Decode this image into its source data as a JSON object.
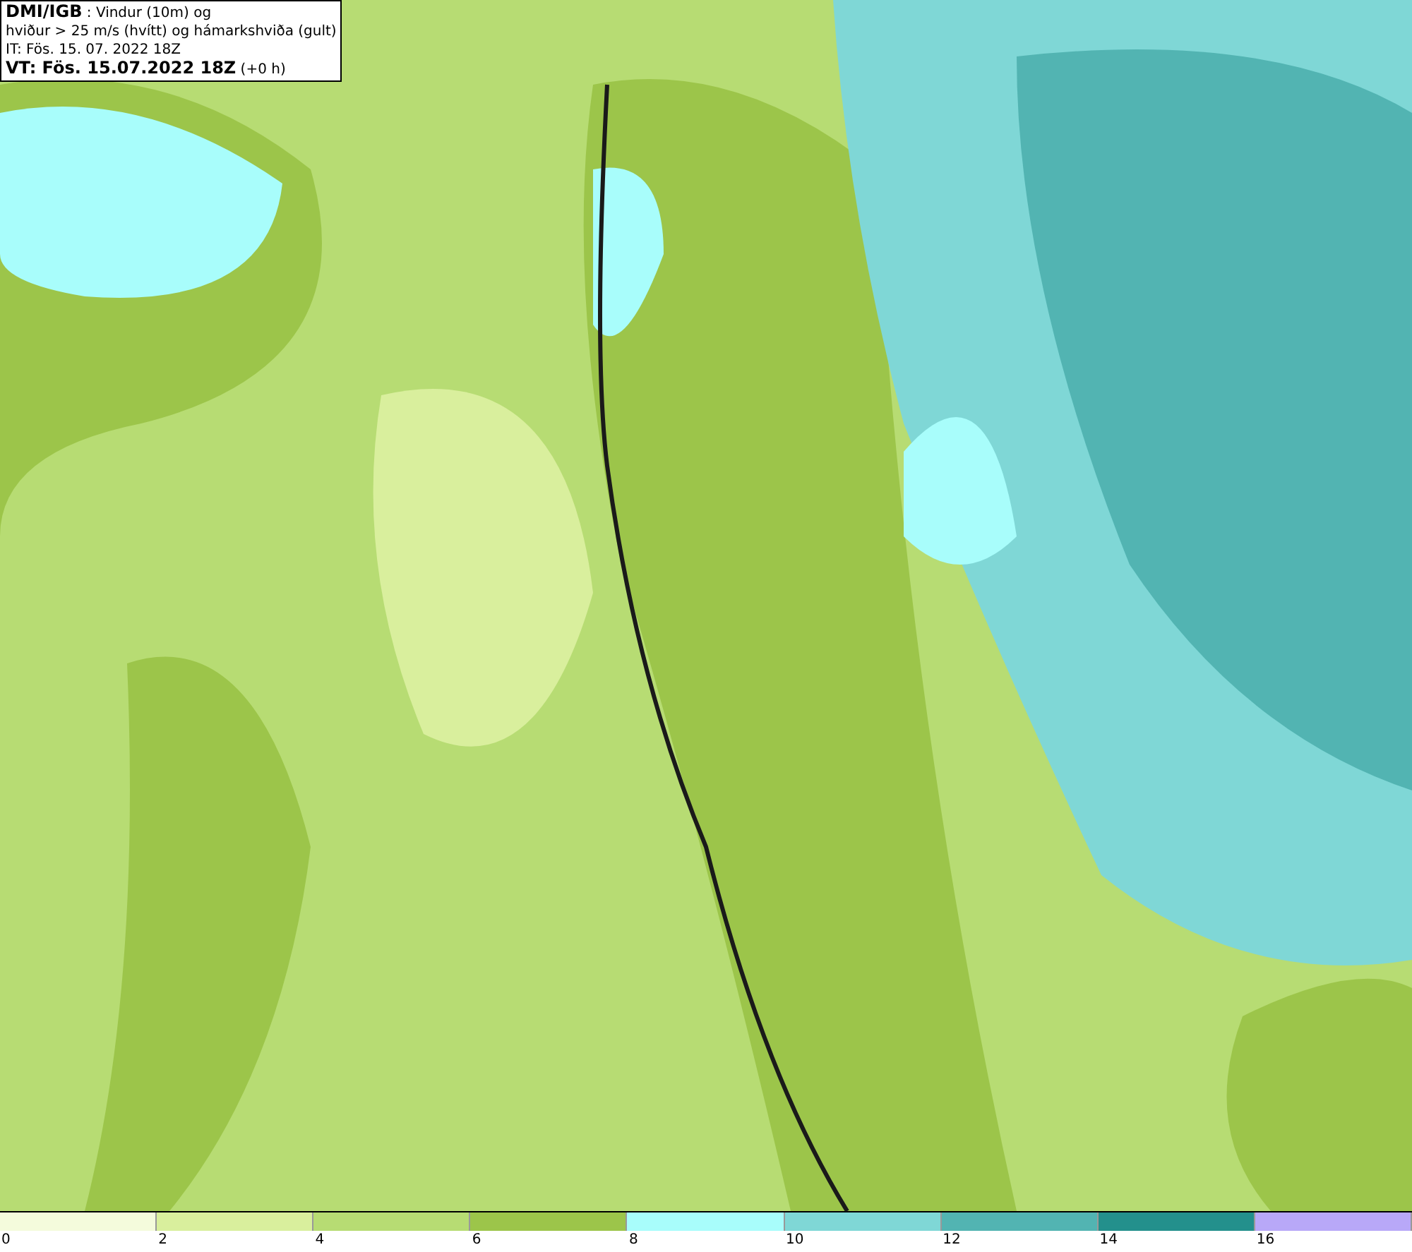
{
  "header": {
    "lines": [
      "**DMI/IGB** : Vindur (10m) og",
      "hviður > 25 m/s (hvítt) og hámarkshviða (gult)",
      "IT: Fös. 15. 07. 2022 18Z",
      "**VT: Fös. 15.07.2022 18Z** (+0 h)"
    ]
  },
  "legend": {
    "bins": [
      {
        "color": "#f4fbdc",
        "label": "0"
      },
      {
        "color": "#d9ef9d",
        "label": "2"
      },
      {
        "color": "#b7dc73",
        "label": "4"
      },
      {
        "color": "#9cc54a",
        "label": "6"
      },
      {
        "color": "#a8fdfb",
        "label": "8"
      },
      {
        "color": "#7fd7d6",
        "label": "10"
      },
      {
        "color": "#52b4b2",
        "label": "12"
      },
      {
        "color": "#23908c",
        "label": "14"
      },
      {
        "color": "#b8a8f8",
        "label": "16"
      }
    ]
  }
}
